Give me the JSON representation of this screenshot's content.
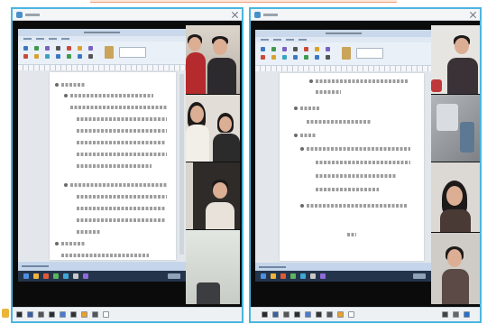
{
  "colors": {
    "window_border": "#4ab6df",
    "title_bar": "#f3f5f7",
    "screen": "#0b0b0b",
    "ribbon": "#eaf0f7",
    "doc_area": "#e3e7ec",
    "page": "#ffffff",
    "remote_taskbar": "#24344a",
    "host_taskbar": "#eef1f4",
    "top_banner": "#f0a07a"
  },
  "windows": [
    {
      "title_icon": "video-call-icon",
      "close_icon": "close-icon"
    },
    {
      "title_icon": "video-call-icon",
      "close_icon": "close-icon"
    }
  ],
  "ribbon_icon_colors": [
    "#3b78c4",
    "#c94a3a",
    "#3f9a4f",
    "#d9a12d",
    "#7a62c2",
    "#3aa3bf",
    "#555555",
    "#3b78c4",
    "#c94a3a",
    "#3f9a4f",
    "#d9a12d",
    "#3b78c4",
    "#7a62c2",
    "#555555"
  ],
  "remote_taskbar_icons": [
    "#4d8fe0",
    "#f0b43c",
    "#e05a3a",
    "#5ab55e",
    "#3fa7d6",
    "#c9c9c9",
    "#8f6ad8"
  ],
  "host_taskbar_icons": {
    "left": [
      "#2a2a2a",
      "#3a5fa0",
      "#555555",
      "#2d2d2d",
      "#4a7bd0",
      "#333333",
      "#e9a12d",
      "#555555",
      "#ffffff"
    ],
    "right": [
      "#2a2a2a",
      "#3a5fa0",
      "#555555",
      "#2d2d2d",
      "#4a7bd0",
      "#333333",
      "#555555",
      "#e9a12d",
      "#ffffff"
    ],
    "tray": [
      "#444444",
      "#666666",
      "#2a6fc8"
    ]
  }
}
